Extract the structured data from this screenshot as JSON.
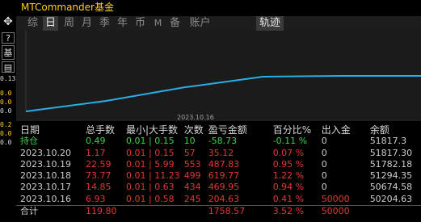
{
  "title": "MTCommander基金",
  "tabs": [
    {
      "label": "综"
    },
    {
      "label": "日"
    },
    {
      "label": "周"
    },
    {
      "label": "月"
    },
    {
      "label": "季"
    },
    {
      "label": "年"
    },
    {
      "label": "币"
    },
    {
      "label": "M"
    },
    {
      "label": "备"
    },
    {
      "label": "账户"
    },
    {
      "label": "轨迹"
    }
  ],
  "side_icons": [
    {
      "name": "move-icon",
      "glyph": "✥"
    },
    {
      "name": "help-icon",
      "glyph": "?"
    },
    {
      "name": "fund-icon",
      "glyph": "基"
    },
    {
      "name": "document-icon",
      "glyph": "▤"
    }
  ],
  "side_numbers": [
    "0.13",
    "0.0",
    "0.0",
    "0.0",
    "0.2",
    "0.0",
    "0.0"
  ],
  "chart_data": {
    "type": "line",
    "x_tick_labels": [
      "2023.10.16"
    ],
    "line_color": "#27aee6",
    "background": "#1b1b1b",
    "series": [
      {
        "values": [
          50204.63,
          50674.58,
          51294.35,
          51782.18,
          51817.3,
          51817.3
        ]
      }
    ]
  },
  "table": {
    "headers": [
      "日期",
      "总手数",
      "最小|大手数",
      "次数",
      "盈亏金额",
      "百分比%",
      "出入金",
      "余额"
    ],
    "holding": {
      "date": "持仓",
      "lots": "0.49",
      "minmax": "0.01 | 0.15",
      "count": "10",
      "pnl": "-58.73",
      "pct": "-0.11 %",
      "flow": "0",
      "balance": "51817.3"
    },
    "rows": [
      {
        "date": "2023.10.20",
        "lots": "1.17",
        "minmax": "0.01 | 0.15",
        "count": "57",
        "pnl": "35.12",
        "pct": "0.07 %",
        "flow": "0",
        "balance": "51817.30"
      },
      {
        "date": "2023.10.19",
        "lots": "22.59",
        "minmax": "0.01 | 5.99",
        "count": "553",
        "pnl": "487.83",
        "pct": "0.95 %",
        "flow": "0",
        "balance": "51782.18"
      },
      {
        "date": "2023.10.18",
        "lots": "73.77",
        "minmax": "0.01 | 11.23",
        "count": "499",
        "pnl": "619.77",
        "pct": "1.22 %",
        "flow": "0",
        "balance": "51294.35"
      },
      {
        "date": "2023.10.17",
        "lots": "14.85",
        "minmax": "0.01 | 0.63",
        "count": "434",
        "pnl": "469.95",
        "pct": "0.94 %",
        "flow": "0",
        "balance": "50674.58"
      },
      {
        "date": "2023.10.16",
        "lots": "6.93",
        "minmax": "0.01 | 0.58",
        "count": "245",
        "pnl": "204.63",
        "pct": "0.41 %",
        "flow": "50000",
        "balance": "50204.63"
      }
    ],
    "total": {
      "date": "合计",
      "lots": "119.80",
      "minmax": "",
      "count": "",
      "pnl": "1758.57",
      "pct": "3.52 %",
      "flow": "50000",
      "balance": ""
    }
  }
}
